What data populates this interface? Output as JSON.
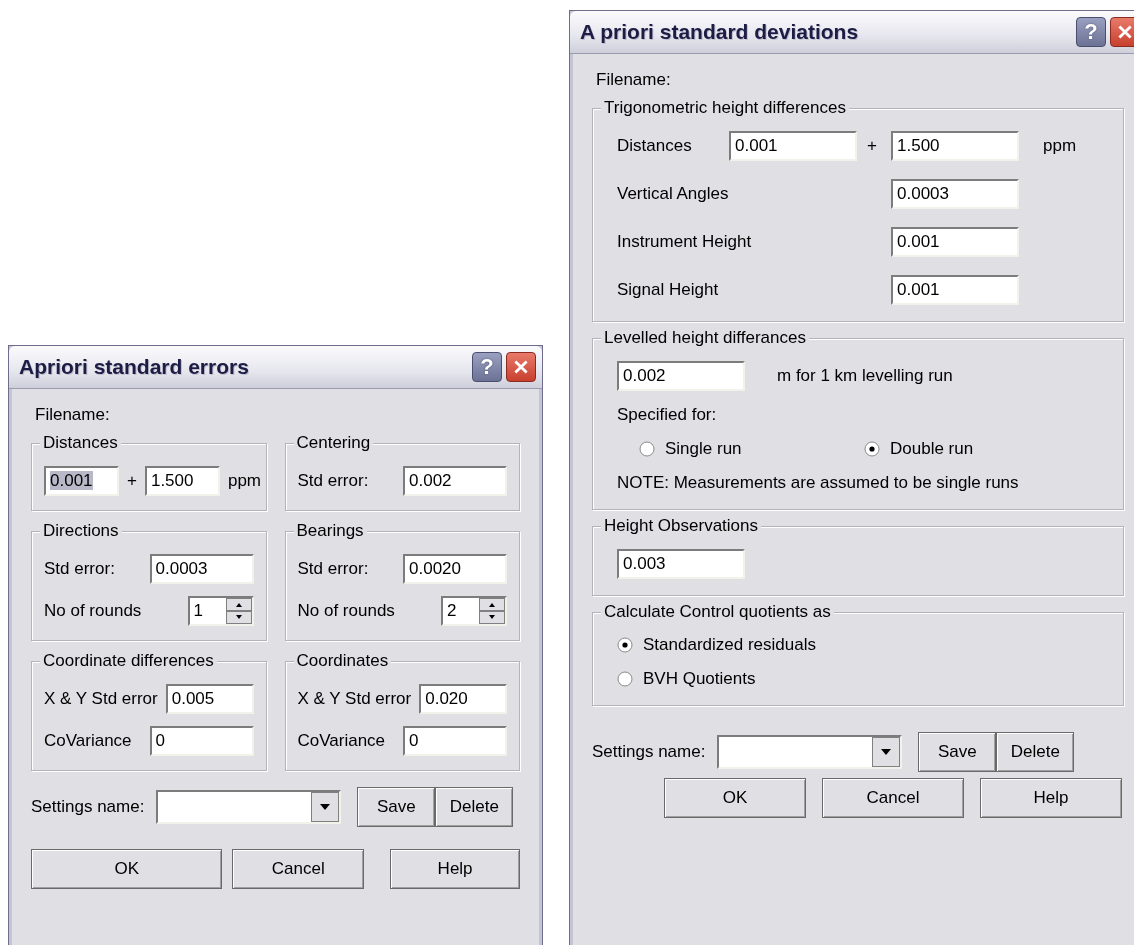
{
  "dialogs": [
    {
      "kind": "two_column",
      "title": "Apriori standard errors",
      "help_glyph": "?",
      "filename_label": "Filename:",
      "groups": [
        {
          "title": "Distances",
          "rows": [
            {
              "kind": "pair",
              "value": "0.001",
              "text_selected": true,
              "plus": "+",
              "value2": "1.500",
              "unit": "ppm"
            }
          ]
        },
        {
          "title": "Centering",
          "rows": [
            {
              "kind": "field",
              "label": "Std error:",
              "value": "0.002"
            }
          ]
        },
        {
          "title": "Directions",
          "rows": [
            {
              "kind": "field",
              "label": "Std error:",
              "value": "0.0003"
            },
            {
              "kind": "spinner",
              "label": "No of rounds",
              "value": "1"
            }
          ]
        },
        {
          "title": "Bearings",
          "rows": [
            {
              "kind": "field",
              "label": "Std error:",
              "value": "0.0020"
            },
            {
              "kind": "spinner",
              "label": "No of rounds",
              "value": "2"
            }
          ]
        },
        {
          "title": "Coordinate differences",
          "rows": [
            {
              "kind": "field",
              "label": "X & Y Std error",
              "value": "0.005"
            },
            {
              "kind": "field",
              "label": "CoVariance",
              "value": "0"
            }
          ]
        },
        {
          "title": "Coordinates",
          "rows": [
            {
              "kind": "field",
              "label": "X & Y Std error",
              "value": "0.020"
            },
            {
              "kind": "field",
              "label": "CoVariance",
              "value": "0"
            }
          ]
        }
      ],
      "settings_label": "Settings name:",
      "settings_buttons": [
        "Save",
        "Delete"
      ],
      "buttons": [
        "OK",
        "Cancel",
        "Help"
      ]
    },
    {
      "kind": "single_column",
      "title": "A priori standard deviations",
      "help_glyph": "?",
      "filename_label": "Filename:",
      "groups": [
        {
          "title": "Trigonometric height differences",
          "rows": [
            {
              "kind": "pair",
              "label": "Distances",
              "value": "0.001",
              "text_selected": false,
              "plus": "+",
              "value2": "1.500",
              "unit": "ppm"
            },
            {
              "kind": "field",
              "label": "Vertical Angles",
              "value": "0.0003"
            },
            {
              "kind": "field",
              "label": "Instrument Height",
              "value": "0.001"
            },
            {
              "kind": "field",
              "label": "Signal Height",
              "value": "0.001"
            }
          ]
        },
        {
          "title": "Levelled height differances",
          "rows": [
            {
              "kind": "input_text",
              "value": "0.002",
              "text": "m for 1 km levelling run"
            },
            {
              "kind": "text",
              "text": "Specified for:"
            },
            {
              "kind": "radio_row",
              "options": [
                {
                  "label": "Single run",
                  "selected": false
                },
                {
                  "label": "Double run",
                  "selected": true
                }
              ]
            },
            {
              "kind": "text",
              "text": "NOTE: Measurements are assumed to be single runs"
            }
          ]
        },
        {
          "title": "Height Observations",
          "rows": [
            {
              "kind": "input",
              "value": "0.003"
            }
          ]
        },
        {
          "title": "Calculate Control quotients as",
          "rows": [
            {
              "kind": "radio",
              "label": "Standardized residuals",
              "selected": true
            },
            {
              "kind": "radio",
              "label": "BVH Quotients",
              "selected": false
            }
          ]
        }
      ],
      "settings_label": "Settings name:",
      "settings_buttons": [
        "Save",
        "Delete"
      ],
      "buttons": [
        "OK",
        "Cancel",
        "Help"
      ]
    }
  ]
}
